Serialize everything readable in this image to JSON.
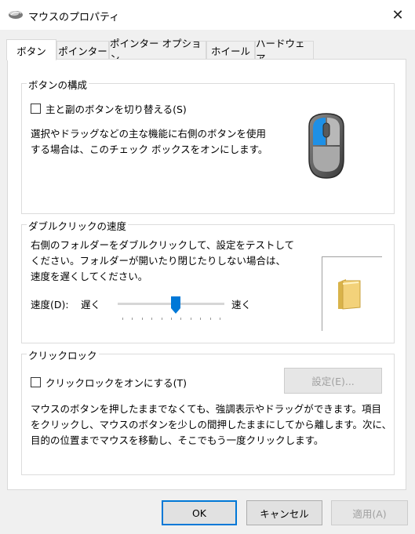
{
  "window": {
    "title": "マウスのプロパティ",
    "close_glyph": "✕"
  },
  "tabs": [
    {
      "label": "ボタン",
      "active": true
    },
    {
      "label": "ポインター"
    },
    {
      "label": "ポインター オプション"
    },
    {
      "label": "ホイール"
    },
    {
      "label": "ハードウェア"
    }
  ],
  "button_config": {
    "group_title": "ボタンの構成",
    "switch_checkbox_label": "主と副のボタンを切り替える(S)",
    "switch_checked": false,
    "description_line1": "選択やドラッグなどの主な機能に右側のボタンを使用",
    "description_line2": "する場合は、このチェック ボックスをオンにします。"
  },
  "double_click": {
    "group_title": "ダブルクリックの速度",
    "description_line1": "右側のフォルダーをダブルクリックして、設定をテストして",
    "description_line2": "ください。フォルダーが開いたり閉じたりしない場合は、",
    "description_line3": "速度を遅くしてください。",
    "speed_label": "速度(D):",
    "slow_label": "遅く",
    "fast_label": "速く",
    "slider_value": 0.55,
    "slider_ticks": 11
  },
  "click_lock": {
    "group_title": "クリックロック",
    "checkbox_label": "クリックロックをオンにする(T)",
    "checked": false,
    "settings_button": "設定(E)...",
    "description_line1": "マウスのボタンを押したままでなくても、強調表示やドラッグができます。項目",
    "description_line2": "をクリックし、マウスのボタンを少しの間押したままにしてから離します。次に、",
    "description_line3": "目的の位置までマウスを移動し、そこでもう一度クリックします。"
  },
  "footer": {
    "ok": "OK",
    "cancel": "キャンセル",
    "apply": "適用(A)"
  },
  "colors": {
    "accent": "#0078d7",
    "mouse_left": "#1e90e6"
  },
  "icons": {
    "app": "mouse-icon",
    "close": "close-icon",
    "folder": "folder-icon"
  }
}
